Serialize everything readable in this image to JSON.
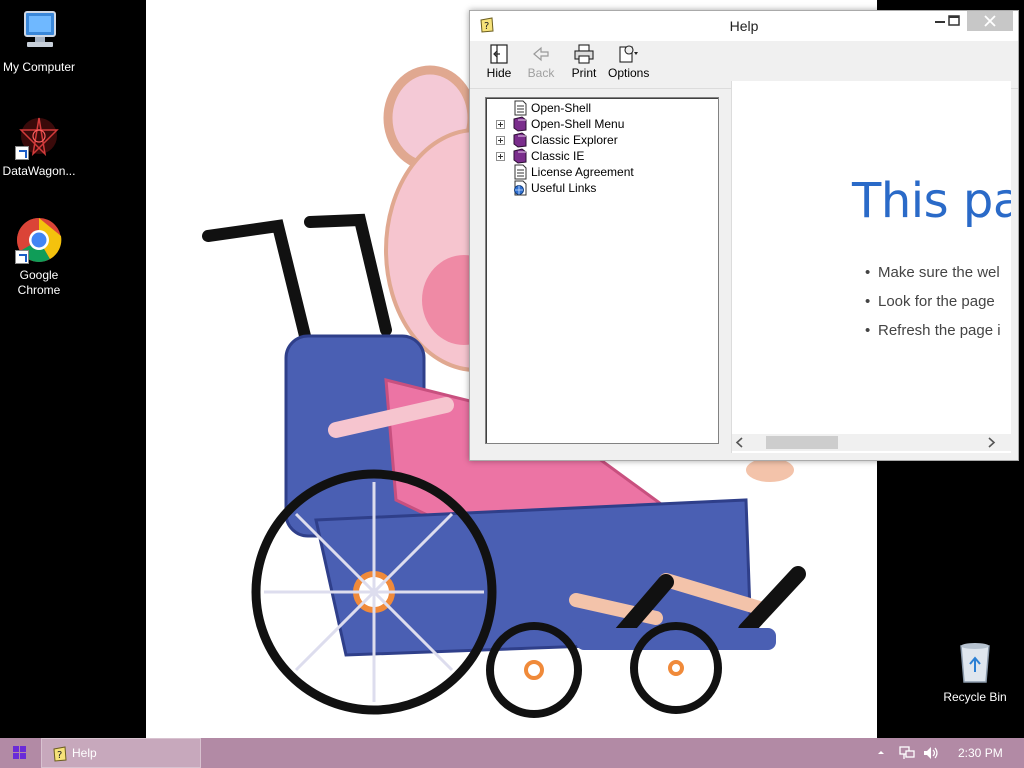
{
  "desktop": {
    "icons": [
      {
        "label": "My Computer",
        "icon": "computer-icon"
      },
      {
        "label": "DataWagon...",
        "icon": "datawagon-icon"
      },
      {
        "label": "Google Chrome",
        "icon": "chrome-icon"
      },
      {
        "label": "Recycle Bin",
        "icon": "recycle-bin-icon"
      }
    ]
  },
  "help_window": {
    "title": "Help",
    "toolbar": [
      {
        "label": "Hide",
        "icon": "hide-icon",
        "enabled": true
      },
      {
        "label": "Back",
        "icon": "back-arrow-icon",
        "enabled": false
      },
      {
        "label": "Print",
        "icon": "printer-icon",
        "enabled": true
      },
      {
        "label": "Options",
        "icon": "options-icon",
        "enabled": true
      }
    ],
    "tree": [
      {
        "label": "Open-Shell",
        "icon": "page-icon",
        "expandable": false
      },
      {
        "label": "Open-Shell Menu",
        "icon": "book-icon",
        "expandable": true
      },
      {
        "label": "Classic Explorer",
        "icon": "book-icon",
        "expandable": true
      },
      {
        "label": "Classic IE",
        "icon": "book-icon",
        "expandable": true
      },
      {
        "label": "License Agreement",
        "icon": "page-icon",
        "expandable": false
      },
      {
        "label": "Useful Links",
        "icon": "globe-page-icon",
        "expandable": false
      }
    ],
    "content": {
      "heading": "This pag",
      "bullets": [
        "Make sure the wel",
        "Look for the page",
        "Refresh the page i"
      ]
    }
  },
  "taskbar": {
    "app_label": "Help",
    "clock": "2:30 PM"
  },
  "colors": {
    "taskbar": "#b28aa5",
    "heading_blue": "#2a6ac8",
    "close_button": "#c7c7c7"
  }
}
